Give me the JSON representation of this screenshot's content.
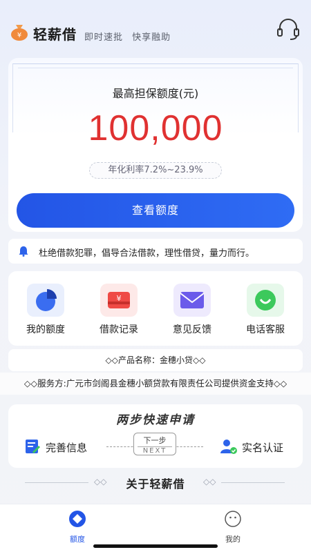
{
  "header": {
    "app_name": "轻薪借",
    "slogans": [
      "即时速批",
      "快享融助"
    ],
    "logo_icon": "money-bag-icon",
    "support_icon": "headset-icon"
  },
  "credit_card": {
    "label": "最高担保额度(元)",
    "amount": "100,000",
    "rate": "年化利率7.2%~23.9%",
    "cta": "查看额度",
    "amount_color": "#e03131",
    "cta_color": "#2355e6"
  },
  "notice": {
    "icon": "bell-icon",
    "text": "杜绝借款犯罪，倡导合法借款，理性借贷，量力而行。"
  },
  "features": [
    {
      "label": "我的额度",
      "icon": "pie-chart-icon"
    },
    {
      "label": "借款记录",
      "icon": "wallet-icon"
    },
    {
      "label": "意见反馈",
      "icon": "mail-icon"
    },
    {
      "label": "电话客服",
      "icon": "chat-smile-icon"
    }
  ],
  "product": {
    "text": "产品名称：金穗小贷",
    "decor": "◇◇"
  },
  "provider": {
    "text": "服务方:广元市剑阁县金穗小额贷款有限责任公司提供资金支持",
    "decor": "◇◇"
  },
  "steps": {
    "title": "两步快速申请",
    "step1": "完善信息",
    "step2": "实名认证",
    "next_cn": "下一步",
    "next_en": "NEXT"
  },
  "about": {
    "title": "关于轻薪借",
    "decor": "◇◇"
  },
  "tabbar": {
    "home_label": "额度",
    "me_label": "我的",
    "active_color": "#2355e6"
  }
}
